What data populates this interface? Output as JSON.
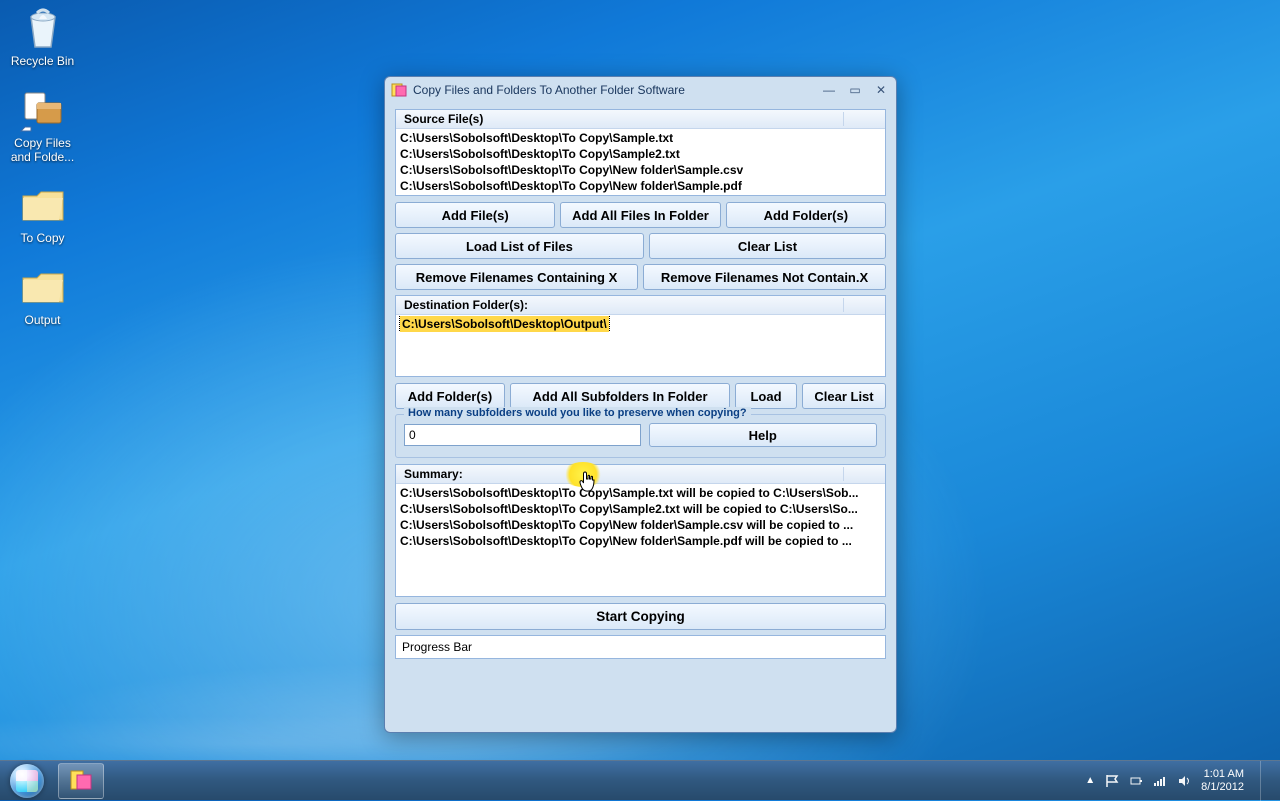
{
  "desktop": {
    "recycle_bin": "Recycle Bin",
    "app_shortcut": "Copy Files and Folde...",
    "folder_tocopy": "To Copy",
    "folder_output": "Output"
  },
  "window": {
    "title": "Copy Files and Folders To Another Folder Software",
    "source_header": "Source File(s)",
    "source_files": [
      "C:\\Users\\Sobolsoft\\Desktop\\To Copy\\Sample.txt",
      "C:\\Users\\Sobolsoft\\Desktop\\To Copy\\Sample2.txt",
      "C:\\Users\\Sobolsoft\\Desktop\\To Copy\\New folder\\Sample.csv",
      "C:\\Users\\Sobolsoft\\Desktop\\To Copy\\New folder\\Sample.pdf"
    ],
    "buttons": {
      "add_files": "Add File(s)",
      "add_all_files_in_folder": "Add All Files In Folder",
      "add_folders": "Add Folder(s)",
      "load_list": "Load List of Files",
      "clear_list": "Clear List",
      "remove_containing": "Remove Filenames Containing X",
      "remove_not_containing": "Remove Filenames Not Contain.X",
      "dest_add_folders": "Add Folder(s)",
      "dest_add_subfolders": "Add All Subfolders In Folder",
      "dest_load": "Load",
      "dest_clear": "Clear List",
      "help": "Help",
      "start": "Start Copying"
    },
    "dest_header": "Destination Folder(s):",
    "dest_folders": [
      "C:\\Users\\Sobolsoft\\Desktop\\Output\\"
    ],
    "subfolder_q": "How many subfolders would you like to preserve when copying?",
    "subfolder_value": "0",
    "summary_header": "Summary:",
    "summary_rows": [
      "C:\\Users\\Sobolsoft\\Desktop\\To Copy\\Sample.txt will be copied to C:\\Users\\Sob...",
      "C:\\Users\\Sobolsoft\\Desktop\\To Copy\\Sample2.txt will be copied to C:\\Users\\So...",
      "C:\\Users\\Sobolsoft\\Desktop\\To Copy\\New folder\\Sample.csv will be copied to ...",
      "C:\\Users\\Sobolsoft\\Desktop\\To Copy\\New folder\\Sample.pdf will be copied to ..."
    ],
    "progress_label": "Progress Bar"
  },
  "taskbar": {
    "time": "1:01 AM",
    "date": "8/1/2012"
  }
}
